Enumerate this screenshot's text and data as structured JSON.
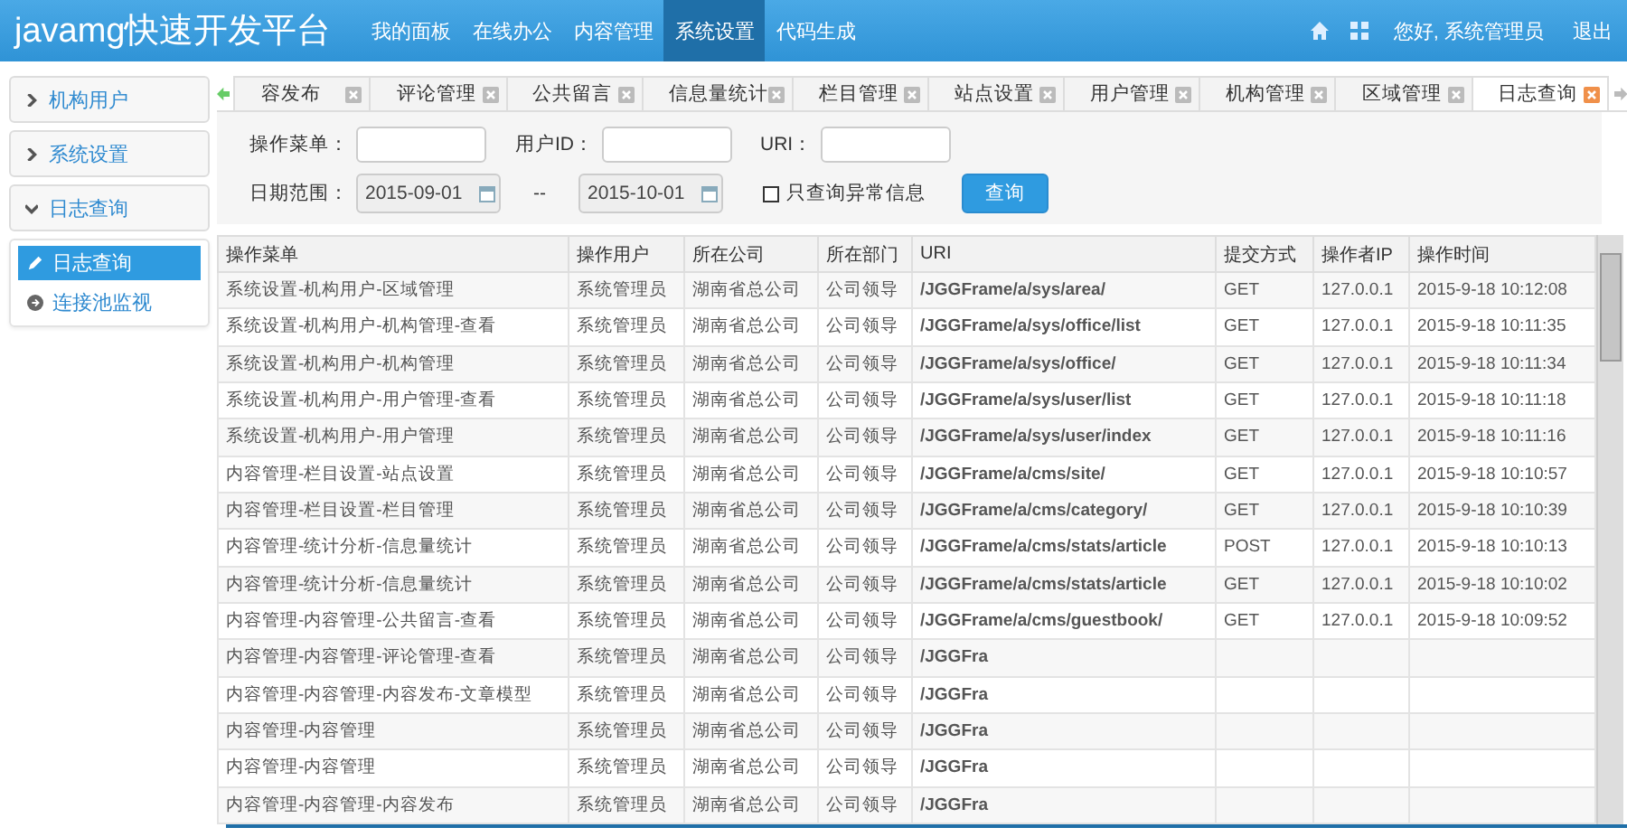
{
  "brand": "javamg快速开发平台",
  "nav": [
    {
      "label": "我的面板",
      "selected": false
    },
    {
      "label": "在线办公",
      "selected": false
    },
    {
      "label": "内容管理",
      "selected": false
    },
    {
      "label": "系统设置",
      "selected": true
    },
    {
      "label": "代码生成",
      "selected": false
    }
  ],
  "user": {
    "greeting": "您好, 系统管理员",
    "logout": "退出"
  },
  "sidebar": {
    "groups": [
      {
        "label": "机构用户",
        "expanded": false
      },
      {
        "label": "系统设置",
        "expanded": false
      },
      {
        "label": "日志查询",
        "expanded": true
      }
    ],
    "items": [
      {
        "label": "日志查询",
        "selected": true,
        "kind": "edit"
      },
      {
        "label": "连接池监视",
        "selected": false,
        "kind": "circle"
      }
    ]
  },
  "tabs": [
    {
      "label": "容发布",
      "selected": false
    },
    {
      "label": "评论管理",
      "selected": false
    },
    {
      "label": "公共留言",
      "selected": false
    },
    {
      "label": "信息量统计",
      "selected": false
    },
    {
      "label": "栏目管理",
      "selected": false
    },
    {
      "label": "站点设置",
      "selected": false
    },
    {
      "label": "用户管理",
      "selected": false
    },
    {
      "label": "机构管理",
      "selected": false
    },
    {
      "label": "区域管理",
      "selected": false
    },
    {
      "label": "日志查询",
      "selected": true
    }
  ],
  "filters": {
    "menu_label": "操作菜单：",
    "user_label": "用户ID：",
    "uri_label": "URI：",
    "date_label": "日期范围：",
    "date_from": "2015-09-01",
    "date_sep": "--",
    "date_to": "2015-10-01",
    "exceptions_only": {
      "label": "只查询异常信息",
      "checked": false
    },
    "search_button": "查询"
  },
  "table": {
    "columns": [
      "操作菜单",
      "操作用户",
      "所在公司",
      "所在部门",
      "URI",
      "提交方式",
      "操作者IP",
      "操作时间"
    ],
    "rows": [
      [
        "系统设置-机构用户-区域管理",
        "系统管理员",
        "湖南省总公司",
        "公司领导",
        "/JGGFrame/a/sys/area/",
        "GET",
        "127.0.0.1",
        "2015-9-18 10:12:08"
      ],
      [
        "系统设置-机构用户-机构管理-查看",
        "系统管理员",
        "湖南省总公司",
        "公司领导",
        "/JGGFrame/a/sys/office/list",
        "GET",
        "127.0.0.1",
        "2015-9-18 10:11:35"
      ],
      [
        "系统设置-机构用户-机构管理",
        "系统管理员",
        "湖南省总公司",
        "公司领导",
        "/JGGFrame/a/sys/office/",
        "GET",
        "127.0.0.1",
        "2015-9-18 10:11:34"
      ],
      [
        "系统设置-机构用户-用户管理-查看",
        "系统管理员",
        "湖南省总公司",
        "公司领导",
        "/JGGFrame/a/sys/user/list",
        "GET",
        "127.0.0.1",
        "2015-9-18 10:11:18"
      ],
      [
        "系统设置-机构用户-用户管理",
        "系统管理员",
        "湖南省总公司",
        "公司领导",
        "/JGGFrame/a/sys/user/index",
        "GET",
        "127.0.0.1",
        "2015-9-18 10:11:16"
      ],
      [
        "内容管理-栏目设置-站点设置",
        "系统管理员",
        "湖南省总公司",
        "公司领导",
        "/JGGFrame/a/cms/site/",
        "GET",
        "127.0.0.1",
        "2015-9-18 10:10:57"
      ],
      [
        "内容管理-栏目设置-栏目管理",
        "系统管理员",
        "湖南省总公司",
        "公司领导",
        "/JGGFrame/a/cms/category/",
        "GET",
        "127.0.0.1",
        "2015-9-18 10:10:39"
      ],
      [
        "内容管理-统计分析-信息量统计",
        "系统管理员",
        "湖南省总公司",
        "公司领导",
        "/JGGFrame/a/cms/stats/article",
        "POST",
        "127.0.0.1",
        "2015-9-18 10:10:13"
      ],
      [
        "内容管理-统计分析-信息量统计",
        "系统管理员",
        "湖南省总公司",
        "公司领导",
        "/JGGFrame/a/cms/stats/article",
        "GET",
        "127.0.0.1",
        "2015-9-18 10:10:02"
      ],
      [
        "内容管理-内容管理-公共留言-查看",
        "系统管理员",
        "湖南省总公司",
        "公司领导",
        "/JGGFrame/a/cms/guestbook/",
        "GET",
        "127.0.0.1",
        "2015-9-18 10:09:52"
      ],
      [
        "内容管理-内容管理-评论管理-查看",
        "系统管理员",
        "湖南省总公司",
        "公司领导",
        "/JGGFra"
      ],
      [
        "内容管理-内容管理-内容发布-文章模型",
        "系统管理员",
        "湖南省总公司",
        "公司领导",
        "/JGGFra"
      ],
      [
        "内容管理-内容管理",
        "系统管理员",
        "湖南省总公司",
        "公司领导",
        "/JGGFra"
      ],
      [
        "内容管理-内容管理",
        "系统管理员",
        "湖南省总公司",
        "公司领导",
        "/JGGFra"
      ],
      [
        "内容管理-内容管理-内容发布",
        "系统管理员",
        "湖南省总公司",
        "公司领导",
        "/JGGFra"
      ]
    ]
  }
}
